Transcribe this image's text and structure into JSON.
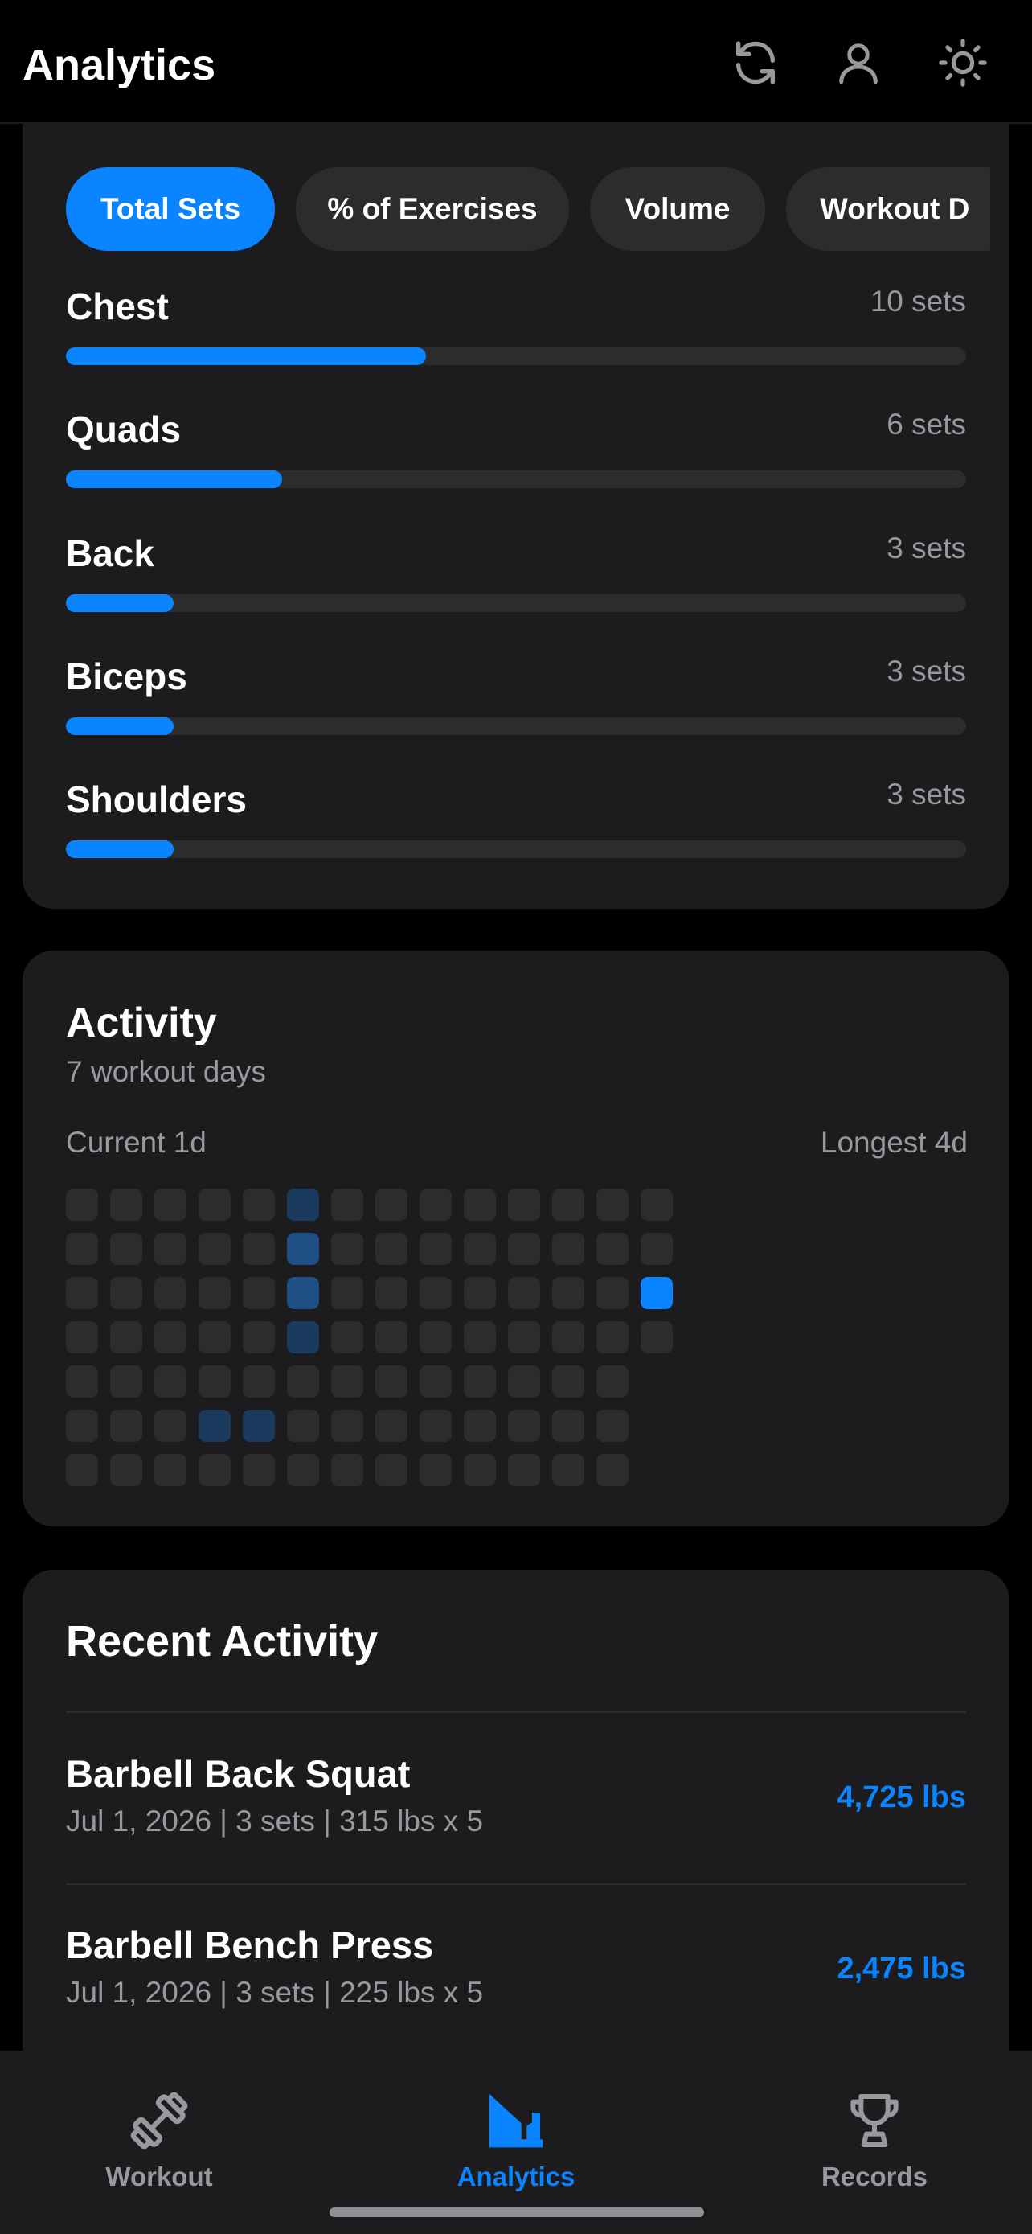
{
  "header": {
    "title": "Analytics",
    "icons": [
      "refresh-icon",
      "profile-icon",
      "theme-sun-icon"
    ]
  },
  "muscle_card": {
    "pills": [
      {
        "label": "Total Sets",
        "active": true
      },
      {
        "label": "% of Exercises",
        "active": false
      },
      {
        "label": "Volume",
        "active": false
      },
      {
        "label": "Workout D",
        "active": false
      }
    ],
    "rows": [
      {
        "name": "Chest",
        "value": "10 sets",
        "fraction": 0.4
      },
      {
        "name": "Quads",
        "value": "6 sets",
        "fraction": 0.24
      },
      {
        "name": "Back",
        "value": "3 sets",
        "fraction": 0.12
      },
      {
        "name": "Biceps",
        "value": "3 sets",
        "fraction": 0.12
      },
      {
        "name": "Shoulders",
        "value": "3 sets",
        "fraction": 0.12
      }
    ]
  },
  "activity": {
    "title": "Activity",
    "subtitle": "7 workout days",
    "current": "Current 1d",
    "longest": "Longest 4d",
    "heatmap": {
      "weeks": 14,
      "days_per_week": 7,
      "last_week_days": 4,
      "active": [
        {
          "week": 5,
          "day": 0,
          "level": 1
        },
        {
          "week": 5,
          "day": 1,
          "level": 2
        },
        {
          "week": 5,
          "day": 2,
          "level": 2
        },
        {
          "week": 5,
          "day": 3,
          "level": 1
        },
        {
          "week": 3,
          "day": 5,
          "level": 1
        },
        {
          "week": 4,
          "day": 5,
          "level": 1
        },
        {
          "week": 13,
          "day": 2,
          "level": 3
        }
      ],
      "level_colors": [
        "#2c2c2e",
        "#1a3a5e",
        "#1f4f85",
        "#0a84ff"
      ]
    }
  },
  "recent": {
    "title": "Recent Activity",
    "items": [
      {
        "name": "Barbell Back Squat",
        "meta": "Jul 1, 2026 | 3 sets | 315 lbs x 5",
        "volume": "4,725 lbs"
      },
      {
        "name": "Barbell Bench Press",
        "meta": "Jul 1, 2026 | 3 sets | 225 lbs x 5",
        "volume": "2,475 lbs"
      }
    ]
  },
  "tabbar": {
    "tabs": [
      {
        "label": "Workout",
        "icon": "dumbbell-icon",
        "active": false
      },
      {
        "label": "Analytics",
        "icon": "analytics-chart-icon",
        "active": true
      },
      {
        "label": "Records",
        "icon": "trophy-icon",
        "active": false
      }
    ]
  },
  "colors": {
    "accent": "#0a84ff",
    "card": "#1c1c1e",
    "track": "#2c2c2e",
    "muted": "#98989d"
  }
}
